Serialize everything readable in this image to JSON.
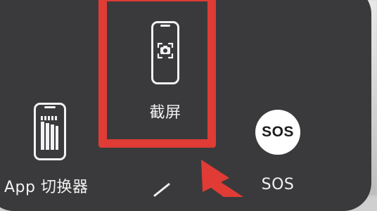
{
  "menu": {
    "screenshot_label": "截屏",
    "app_switcher_label": "App 切换器",
    "sos_icon_text": "SOS",
    "sos_label": "SOS"
  },
  "annotation": {
    "highlight_color": "#e03b35"
  },
  "icons": {
    "screenshot": "phone-camera-icon",
    "app_switcher": "phone-bars-icon",
    "sos": "sos-circle-icon"
  }
}
